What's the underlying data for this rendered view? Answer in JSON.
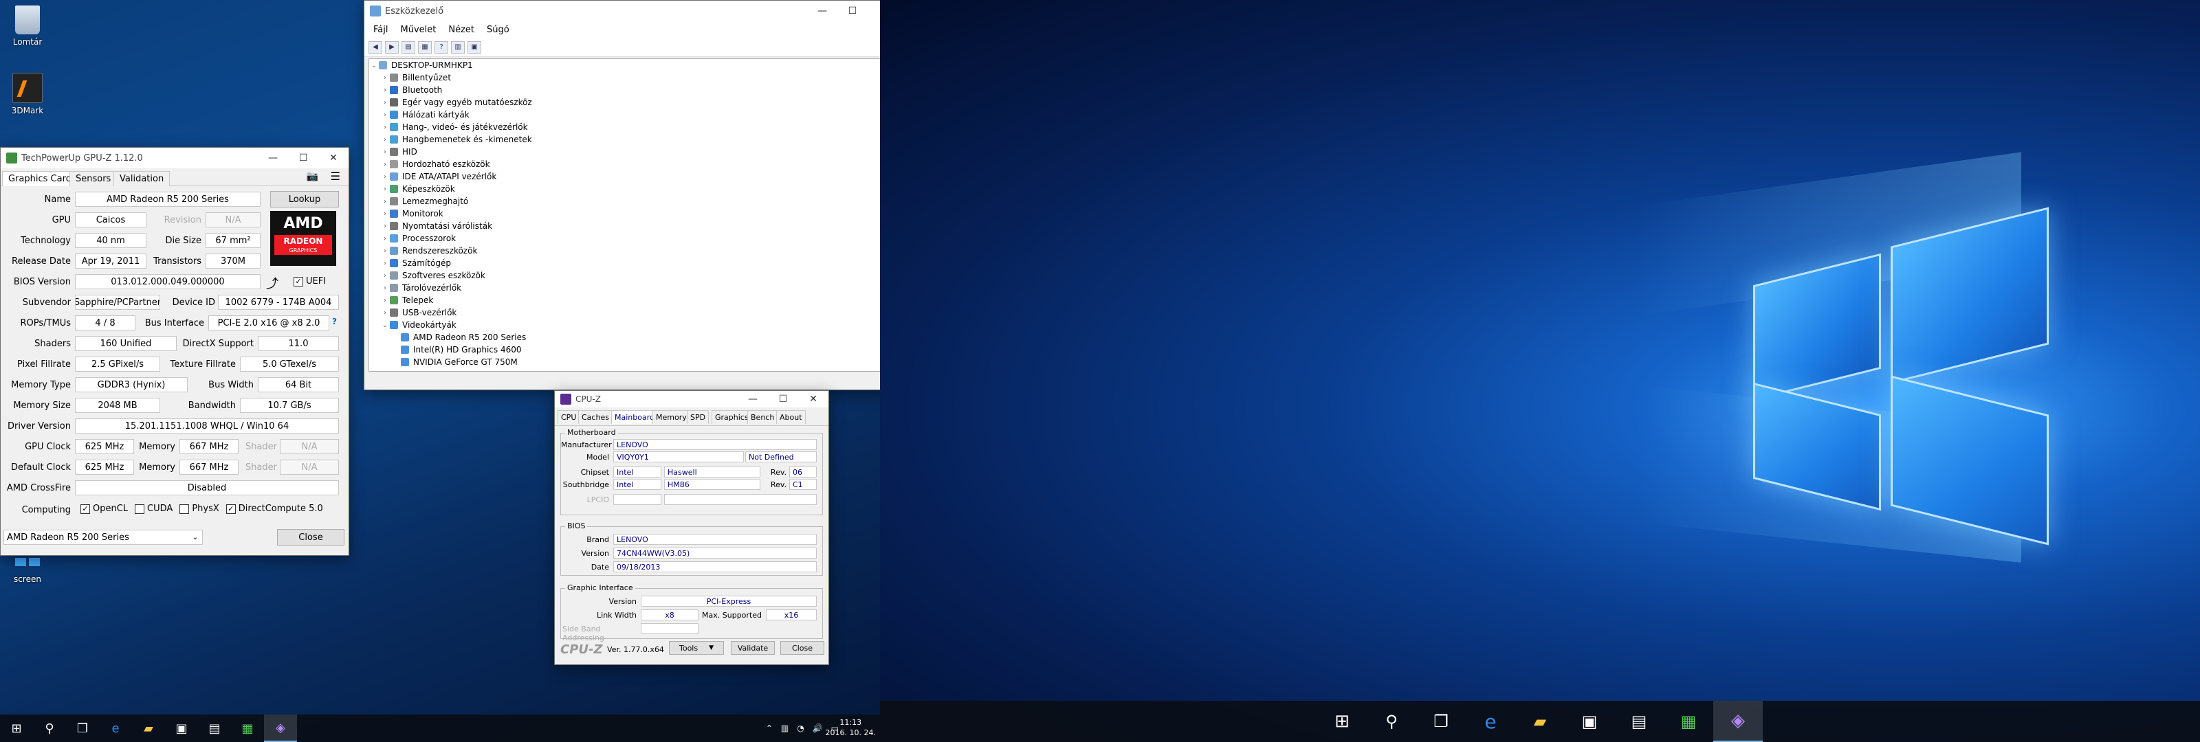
{
  "desktop": {
    "icons": [
      {
        "label": "Lomtár"
      },
      {
        "label": "3DMark"
      },
      {
        "label": "screen"
      }
    ]
  },
  "device_manager": {
    "title": "Eszközkezelő",
    "menu": [
      "Fájl",
      "Művelet",
      "Nézet",
      "Súgó"
    ],
    "root": "DESKTOP-URMHKP1",
    "categories": [
      "Billentyűzet",
      "Bluetooth",
      "Egér vagy egyéb mutatóeszköz",
      "Hálózati kártyák",
      "Hang-, videó- és játékvezérlők",
      "Hangbemenetek és -kimenetek",
      "HID",
      "Hordozható eszközök",
      "IDE ATA/ATAPI vezérlők",
      "Képeszközök",
      "Lemezmeghajtó",
      "Monitorok",
      "Nyomtatási várólisták",
      "Processzorok",
      "Rendszereszközök",
      "Számítógép",
      "Szoftveres eszközök",
      "Tárolóvezérlők",
      "Telepek",
      "USB-vezérlők",
      "Videokártyák"
    ],
    "display_adapters": [
      "AMD Radeon R5 200 Series",
      "Intel(R) HD Graphics 4600",
      "NVIDIA GeForce GT 750M"
    ]
  },
  "gpuz": {
    "title": "TechPowerUp GPU-Z 1.12.0",
    "tabs": [
      "Graphics Card",
      "Sensors",
      "Validation"
    ],
    "name_label": "Name",
    "name": "AMD Radeon R5 200 Series",
    "lookup": "Lookup",
    "gpu_label": "GPU",
    "gpu": "Caicos",
    "revision_label": "Revision",
    "revision": "N/A",
    "tech_label": "Technology",
    "tech": "40 nm",
    "die_label": "Die Size",
    "die": "67 mm²",
    "release_label": "Release Date",
    "release": "Apr 19, 2011",
    "trans_label": "Transistors",
    "trans": "370M",
    "bios_label": "BIOS Version",
    "bios": "013.012.000.049.000000",
    "uefi": "UEFI",
    "subv_label": "Subvendor",
    "subv": "Sapphire/PCPartner",
    "devid_label": "Device ID",
    "devid": "1002 6779 - 174B A004",
    "rops_label": "ROPs/TMUs",
    "rops": "4 / 8",
    "bus_label": "Bus Interface",
    "bus": "PCI-E 2.0 x16 @ x8 2.0",
    "help": "?",
    "shaders_label": "Shaders",
    "shaders": "160 Unified",
    "dx_label": "DirectX Support",
    "dx": "11.0",
    "pix_label": "Pixel Fillrate",
    "pix": "2.5 GPixel/s",
    "tex_label": "Texture Fillrate",
    "tex": "5.0 GTexel/s",
    "memtype_label": "Memory Type",
    "memtype": "GDDR3 (Hynix)",
    "bw_label": "Bus Width",
    "bw": "64 Bit",
    "memsize_label": "Memory Size",
    "memsize": "2048 MB",
    "band_label": "Bandwidth",
    "band": "10.7 GB/s",
    "drv_label": "Driver Version",
    "drv": "15.201.1151.1008 WHQL / Win10 64",
    "gpuclk_label": "GPU Clock",
    "gpuclk": "625 MHz",
    "mem_label": "Memory",
    "memclk": "667 MHz",
    "shader_label": "Shader",
    "shader": "N/A",
    "defclk_label": "Default Clock",
    "defclk": "625 MHz",
    "defmem": "667 MHz",
    "defshader": "N/A",
    "cf_label": "AMD CrossFire",
    "cf": "Disabled",
    "comp_label": "Computing",
    "opencl": "OpenCL",
    "cuda": "CUDA",
    "physx": "PhysX",
    "dc": "DirectCompute 5.0",
    "select": "AMD Radeon R5 200 Series",
    "close": "Close",
    "logo_top": "AMD",
    "logo_mid": "RADEON",
    "logo_bot": "GRAPHICS"
  },
  "cpuz": {
    "title": "CPU-Z",
    "tabs": [
      "CPU",
      "Caches",
      "Mainboard",
      "Memory",
      "SPD",
      "Graphics",
      "Bench",
      "About"
    ],
    "mb_group": "Motherboard",
    "manuf_label": "Manufacturer",
    "manuf": "LENOVO",
    "model_label": "Model",
    "model": "VIQY0Y1",
    "model2": "Not Defined",
    "chipset_label": "Chipset",
    "chipset": "Intel",
    "chipset2": "Haswell",
    "rev_label": "Rev.",
    "rev1": "06",
    "sb_label": "Southbridge",
    "sb": "Intel",
    "sb2": "HM86",
    "rev2": "C1",
    "lpcio_label": "LPCIO",
    "bios_group": "BIOS",
    "brand_label": "Brand",
    "brand": "LENOVO",
    "ver_label": "Version",
    "ver": "74CN44WW(V3.05)",
    "date_label": "Date",
    "date": "09/18/2013",
    "gi_group": "Graphic Interface",
    "giver_label": "Version",
    "giver": "PCI-Express",
    "lw_label": "Link Width",
    "lw": "x8",
    "ms_label": "Max. Supported",
    "ms": "x16",
    "sba_label": "Side Band Addressing",
    "brand_text": "CPU-Z",
    "version": "Ver. 1.77.0.x64",
    "tools": "Tools",
    "validate": "Validate",
    "close": "Close"
  },
  "taskbar": {
    "time": "11:13",
    "date": "2016. 10. 24."
  },
  "colors": {
    "accent": "#0078d7",
    "amd_red": "#ed1c24"
  }
}
